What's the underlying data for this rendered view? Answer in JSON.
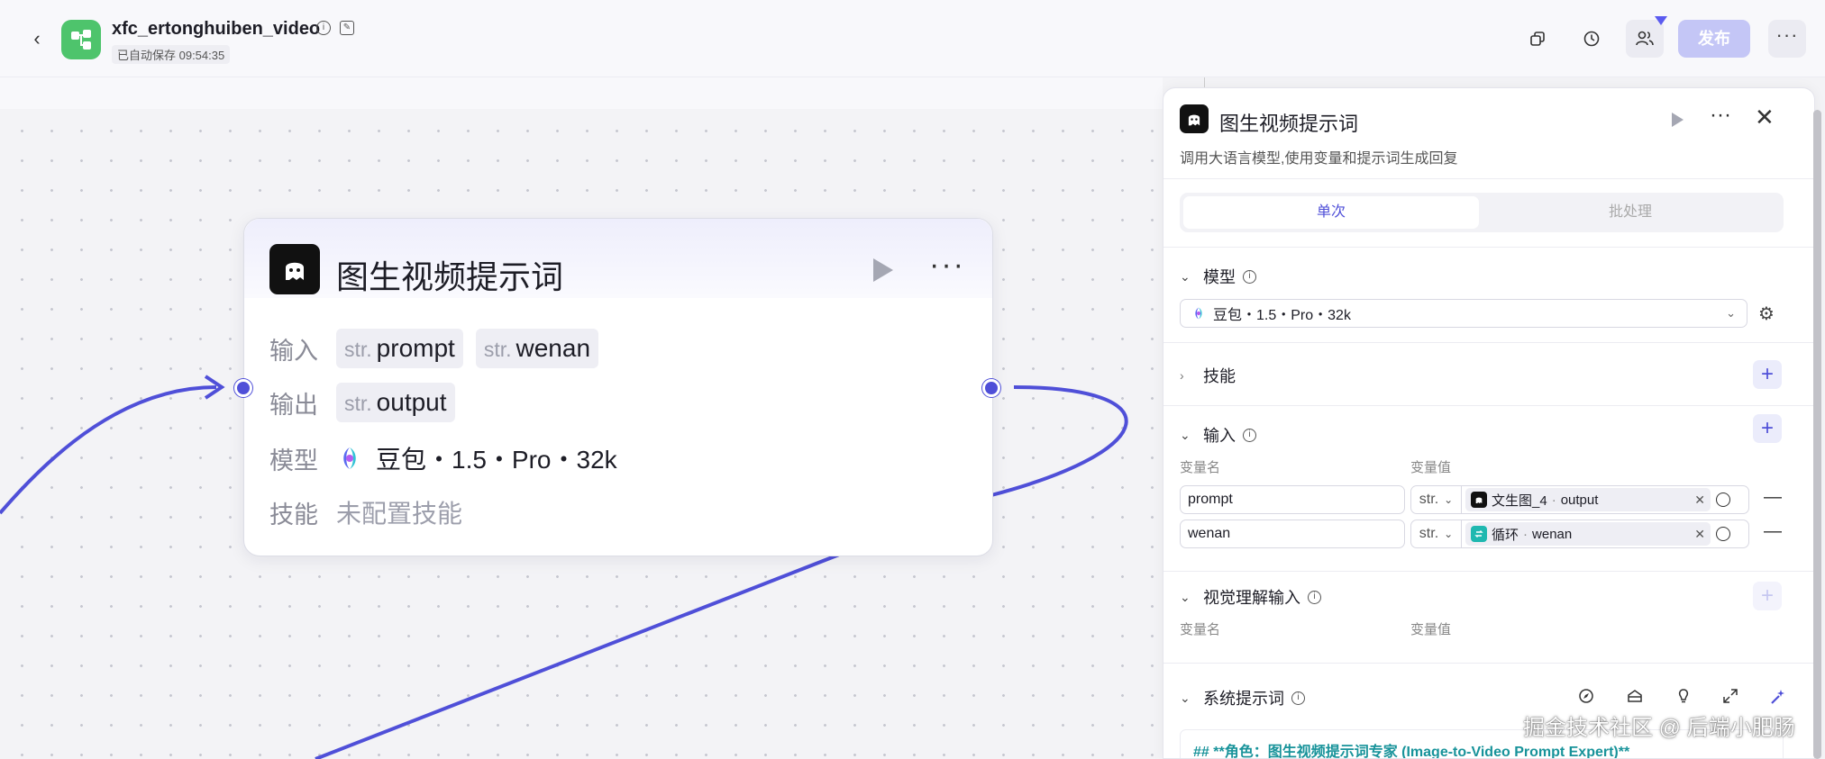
{
  "header": {
    "title": "xfc_ertonghuiben_video",
    "autosave": "已自动保存 09:54:35",
    "publish_label": "发布",
    "more_label": "···"
  },
  "node": {
    "title": "图生视频提示词",
    "input_label": "输入",
    "output_label": "输出",
    "model_label": "模型",
    "skill_label": "技能",
    "type_prefix": "str.",
    "inputs": [
      "prompt",
      "wenan"
    ],
    "output": "output",
    "model": "豆包・1.5・Pro・32k",
    "skill_value": "未配置技能"
  },
  "panel": {
    "title": "图生视频提示词",
    "description": "调用大语言模型,使用变量和提示词生成回复",
    "tab_single": "单次",
    "tab_batch": "批处理",
    "model_section": "模型",
    "model_value": "豆包・1.5・Pro・32k",
    "skill_section": "技能",
    "input_section": "输入",
    "var_name_header": "变量名",
    "var_value_header": "变量值",
    "type_prefix": "str.",
    "inputs": [
      {
        "name": "prompt",
        "ref_node": "文生图_4",
        "ref_var": "output"
      },
      {
        "name": "wenan",
        "ref_node": "循环",
        "ref_var": "wenan"
      }
    ],
    "visual_section": "视觉理解输入",
    "visual_name_header": "变量名",
    "visual_value_header": "变量值",
    "system_prompt_section": "系统提示词",
    "system_prompt_text": "## **角色：图生视频提示词专家 (Image-to-Video Prompt Expert)**"
  },
  "watermark": "掘金技术社区 @ 后端小肥肠",
  "colors": {
    "accent": "#4f4fd8",
    "app_logo": "#4ec46c",
    "publish_disabled": "#c4c6f6",
    "edge": "#4f4fd8"
  }
}
